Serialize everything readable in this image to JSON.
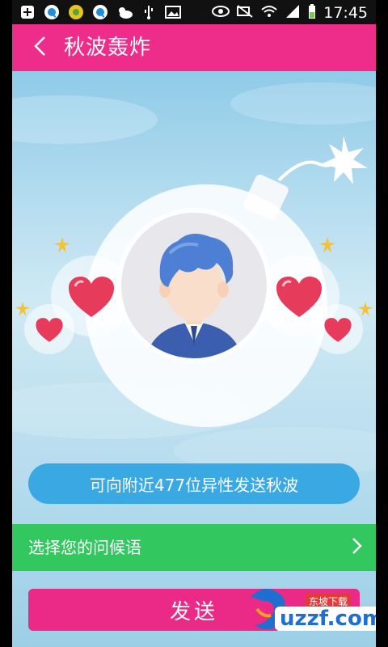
{
  "status_bar": {
    "time": "17:45",
    "left_icons": [
      "add-icon",
      "q-app-icon",
      "game-icon",
      "q-app-icon-2",
      "weather-icon",
      "usb-icon",
      "image-icon"
    ],
    "right_icons": [
      "eye-icon",
      "nfc-mute-icon",
      "wifi-icon",
      "signal-icon",
      "battery-icon"
    ]
  },
  "app_bar": {
    "back_icon": "chevron-left-icon",
    "title": "秋波轰炸"
  },
  "main": {
    "count_text": "可向附近477位异性发送秋波",
    "greeting_label": "选择您的问候语",
    "greeting_icon": "chevron-right-icon",
    "send_label": "发送"
  },
  "watermark": {
    "top_text": "东坡下载",
    "main_text": "uzzf.com"
  },
  "colors": {
    "app_bar": "#ee2d8b",
    "pill": "#3aa9e3",
    "greeting": "#33c85f",
    "send": "#ea2a86",
    "heart": "#e63b5b"
  }
}
